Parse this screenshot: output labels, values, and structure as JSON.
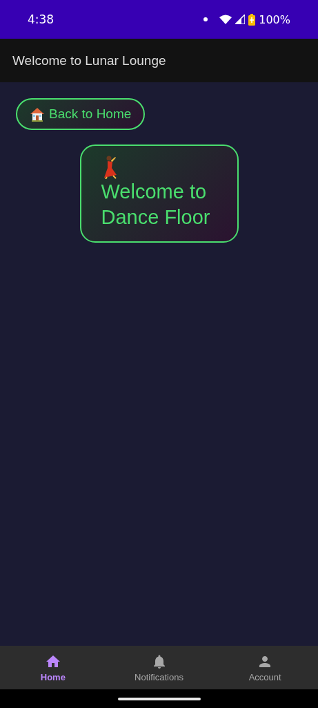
{
  "status_bar": {
    "time": "4:38",
    "battery": "100%"
  },
  "app_bar": {
    "title": "Welcome to Lunar Lounge"
  },
  "back_button": {
    "label": "Back to Home"
  },
  "card": {
    "title": "Welcome to Dance Floor"
  },
  "bottom_nav": [
    {
      "kind": "home",
      "label": "Home",
      "selected": true
    },
    {
      "kind": "bell",
      "label": "Notifications",
      "selected": false
    },
    {
      "kind": "person",
      "label": "Account",
      "selected": false
    }
  ]
}
